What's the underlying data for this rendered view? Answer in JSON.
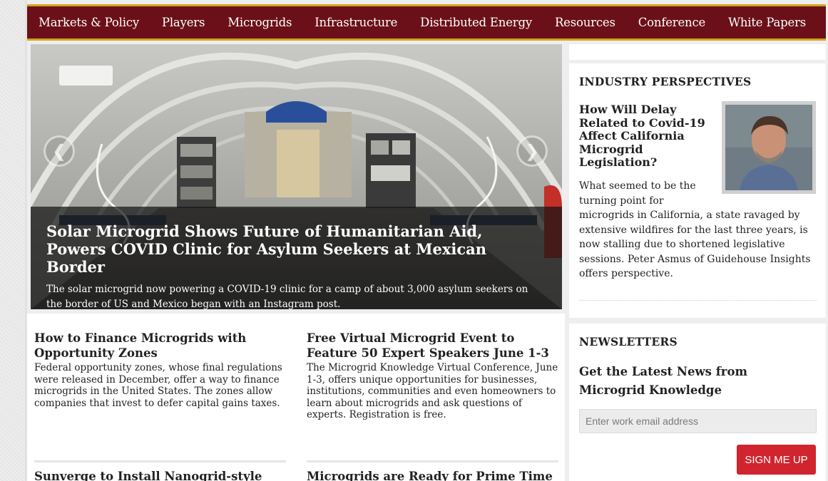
{
  "nav": {
    "items": [
      "Markets & Policy",
      "Players",
      "Microgrids",
      "Infrastructure",
      "Distributed Energy",
      "Resources",
      "Conference",
      "White Papers"
    ]
  },
  "hero": {
    "title": "Solar Microgrid Shows Future of Humanitarian Aid, Powers COVID Clinic for Asylum Seekers at Mexican Border",
    "description": "The solar microgrid now powering a COVID-19 clinic for a camp of about 3,000 asylum seekers on the border of US and Mexico began with an Instagram post.",
    "prev_glyph": "❮",
    "next_glyph": "❯"
  },
  "articles": [
    {
      "title": "How to Finance Microgrids with Opportunity Zones",
      "description": "Federal opportunity zones, whose final regulations were released in December, offer a way to finance microgrids in the United States. The zones allow companies that invest to defer capital gains taxes."
    },
    {
      "title": "Free Virtual Microgrid Event to Feature 50 Expert Speakers June 1-3",
      "description": "The Microgrid Knowledge Virtual Conference, June 1-3, offers unique opportunities for businesses, institutions, communities and even homeowners to learn about microgrids and ask questions of experts. Registration is free."
    },
    {
      "title": "Sunverge to Install Nanogrid-style",
      "description": ""
    },
    {
      "title": "Microgrids are Ready for Prime Time in",
      "description": ""
    }
  ],
  "perspectives": {
    "heading": "INDUSTRY PERSPECTIVES",
    "title": "How Will Delay Related to Covid-19 Affect California Microgrid Legislation?",
    "text_short": "What seemed to be the turning point for",
    "text_long": "microgrids in California, a state ravaged by extensive wildfires for the last three years, is now stalling due to shortened legislative sessions. Peter Asmus of Guidehouse Insights offers perspective."
  },
  "newsletter": {
    "heading": "NEWSLETTERS",
    "subheading": "Get the Latest News from Microgrid Knowledge",
    "email_placeholder": "Enter work email address",
    "button_label": "SIGN ME UP"
  },
  "colors": {
    "nav_bg": "#6b1018",
    "nav_accent": "#d4a21a",
    "signup_button": "#d0242e"
  },
  "icons": {
    "prev": "chevron-left-icon",
    "next": "chevron-right-icon"
  }
}
